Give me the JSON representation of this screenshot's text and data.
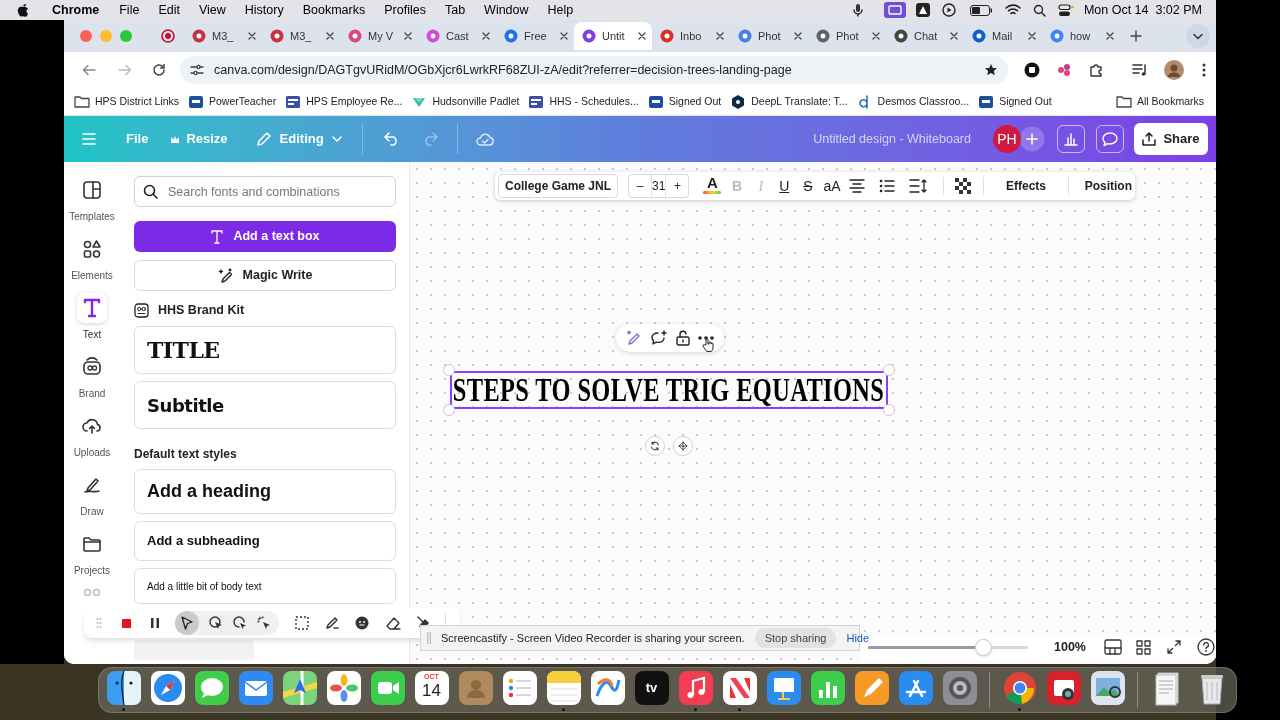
{
  "menu_bar": {
    "app": "Chrome",
    "items": [
      "File",
      "Edit",
      "View",
      "History",
      "Bookmarks",
      "Profiles",
      "Tab",
      "Window",
      "Help"
    ],
    "clock": "Mon Oct 14  3:02 PM"
  },
  "tabs": [
    {
      "label": "M3_",
      "selected": false
    },
    {
      "label": "M3_",
      "selected": false
    },
    {
      "label": "My V",
      "selected": false
    },
    {
      "label": "Cast",
      "selected": false
    },
    {
      "label": "Free",
      "selected": false
    },
    {
      "label": "Untit",
      "selected": true
    },
    {
      "label": "Inbo",
      "selected": false
    },
    {
      "label": "Phot",
      "selected": false
    },
    {
      "label": "Phot",
      "selected": false
    },
    {
      "label": "Chat",
      "selected": false
    },
    {
      "label": "Mail",
      "selected": false
    },
    {
      "label": "how",
      "selected": false
    }
  ],
  "address_bar": {
    "url": "canva.com/design/DAGTgvURidM/OGbXjcr6LwrkRF68ZUI-zA/edit?referrer=decision-trees-landing-page"
  },
  "bookmarks": [
    {
      "label": "HPS District Links",
      "kind": "folder"
    },
    {
      "label": "PowerTeacher",
      "kind": "sis"
    },
    {
      "label": "HPS Employee Re...",
      "kind": "page"
    },
    {
      "label": "Hudsonville Padlet",
      "kind": "padlet"
    },
    {
      "label": "HHS - Schedules...",
      "kind": "page"
    },
    {
      "label": "Signed Out",
      "kind": "sis"
    },
    {
      "label": "DeepL Translate: T...",
      "kind": "deepl"
    },
    {
      "label": "Desmos Classroo...",
      "kind": "desmos"
    },
    {
      "label": "Signed Out",
      "kind": "sis"
    }
  ],
  "all_bookmarks": "All Bookmarks",
  "editor_header": {
    "file": "File",
    "resize": "Resize",
    "mode": "Editing",
    "redo": {
      "disabled": true
    },
    "design_title": "Untitled design - Whiteboard",
    "avatar": "PH",
    "share": "Share"
  },
  "rail": [
    {
      "label": "Templates",
      "selected": false
    },
    {
      "label": "Elements",
      "selected": false
    },
    {
      "label": "Text",
      "selected": true
    },
    {
      "label": "Brand",
      "selected": false
    },
    {
      "label": "Uploads",
      "selected": false
    },
    {
      "label": "Draw",
      "selected": false
    },
    {
      "label": "Projects",
      "selected": false
    }
  ],
  "panel": {
    "search_placeholder": "Search fonts and combinations",
    "primary_button": "Add a text box",
    "magic_button": "Magic Write",
    "brand_kit": "HHS Brand Kit",
    "brand_styles": [
      {
        "kind": "title",
        "label": "TITLE"
      },
      {
        "kind": "subtitle",
        "label": "Subtitle"
      }
    ],
    "default_heading": "Default text styles",
    "default_styles": [
      {
        "kind": "heading",
        "label": "Add a heading"
      },
      {
        "kind": "subheading",
        "label": "Add a subheading"
      },
      {
        "kind": "body",
        "label": "Add a little bit of body text"
      }
    ]
  },
  "text_toolbar": {
    "font": "College Game JNL",
    "size_minus": "–",
    "size": "31",
    "size_plus": "+",
    "color_label": "A",
    "formats": [
      {
        "kind": "bold",
        "label": "B",
        "disabled": true
      },
      {
        "kind": "italic",
        "label": "I",
        "disabled": true
      },
      {
        "kind": "underline",
        "label": "U",
        "disabled": false
      },
      {
        "kind": "strike",
        "label": "S",
        "disabled": false
      },
      {
        "kind": "case",
        "label": "aA",
        "disabled": false
      }
    ],
    "effects": "Effects",
    "position": "Position"
  },
  "canvas": {
    "heading": "STEPS TO SOLVE TRIG EQUATIONS",
    "selected": true
  },
  "zoom": {
    "level": 0.72,
    "reading": "100%"
  },
  "screen_share": {
    "message": "Screencastify - Screen Video Recorder is sharing your screen.",
    "stop": "Stop sharing",
    "hide": "Hide"
  },
  "dock": [
    {
      "kind": "finder",
      "running": true
    },
    {
      "kind": "safari",
      "running": false
    },
    {
      "kind": "messages",
      "running": false
    },
    {
      "kind": "mail",
      "running": false
    },
    {
      "kind": "maps",
      "running": false
    },
    {
      "kind": "photos",
      "running": false
    },
    {
      "kind": "facetime",
      "running": false
    },
    {
      "kind": "calendar",
      "running": false,
      "month": "OCT",
      "day": "14"
    },
    {
      "kind": "contacts",
      "running": false
    },
    {
      "kind": "reminders",
      "running": false
    },
    {
      "kind": "notes",
      "running": true
    },
    {
      "kind": "freeform",
      "running": false
    },
    {
      "kind": "tv",
      "running": false,
      "text": "tv"
    },
    {
      "kind": "music",
      "running": true
    },
    {
      "kind": "news",
      "running": true
    },
    {
      "kind": "keynote",
      "running": false
    },
    {
      "kind": "numbers",
      "running": false
    },
    {
      "kind": "pages",
      "running": false
    },
    {
      "kind": "appstore",
      "running": false
    },
    {
      "kind": "settings",
      "running": false
    },
    {
      "kind": "separator"
    },
    {
      "kind": "chrome",
      "running": true
    },
    {
      "kind": "photobooth",
      "running": false
    },
    {
      "kind": "preview",
      "running": false
    },
    {
      "kind": "separator"
    },
    {
      "kind": "stack",
      "running": false
    },
    {
      "kind": "trash",
      "running": false
    }
  ]
}
